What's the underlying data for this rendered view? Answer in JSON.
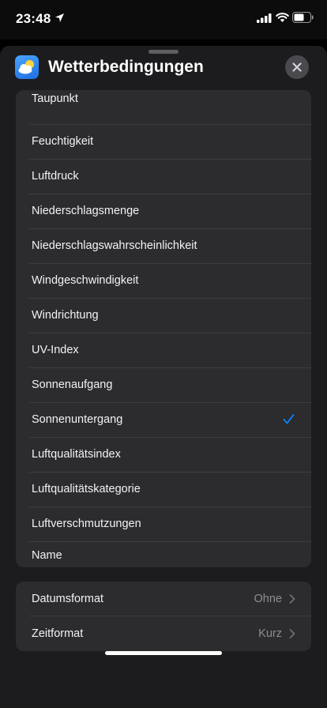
{
  "status_bar": {
    "time": "23:48",
    "icons": [
      "location-arrow-icon",
      "cellular-signal-icon",
      "wifi-icon",
      "battery-icon"
    ]
  },
  "sheet": {
    "title": "Wetterbedingungen",
    "app_icon": "weather-app-icon",
    "close_icon": "close-icon"
  },
  "conditions": {
    "items": [
      {
        "label": "Taupunkt",
        "checked": false
      },
      {
        "label": "Feuchtigkeit",
        "checked": false
      },
      {
        "label": "Luftdruck",
        "checked": false
      },
      {
        "label": "Niederschlagsmenge",
        "checked": false
      },
      {
        "label": "Niederschlagswahrscheinlichkeit",
        "checked": false
      },
      {
        "label": "Windgeschwindigkeit",
        "checked": false
      },
      {
        "label": "Windrichtung",
        "checked": false
      },
      {
        "label": "UV-Index",
        "checked": false
      },
      {
        "label": "Sonnenaufgang",
        "checked": false
      },
      {
        "label": "Sonnenuntergang",
        "checked": true
      },
      {
        "label": "Luftqualitätsindex",
        "checked": false
      },
      {
        "label": "Luftqualitätskategorie",
        "checked": false
      },
      {
        "label": "Luftverschmutzungen",
        "checked": false
      },
      {
        "label": "Name",
        "checked": false
      }
    ]
  },
  "settings": {
    "date_format": {
      "label": "Datumsformat",
      "value": "Ohne"
    },
    "time_format": {
      "label": "Zeitformat",
      "value": "Kurz"
    }
  },
  "colors": {
    "accent": "#0a84ff",
    "sheet_background": "#1c1c1e",
    "card_background": "#2c2c2e",
    "secondary_text": "#8e8e93"
  }
}
